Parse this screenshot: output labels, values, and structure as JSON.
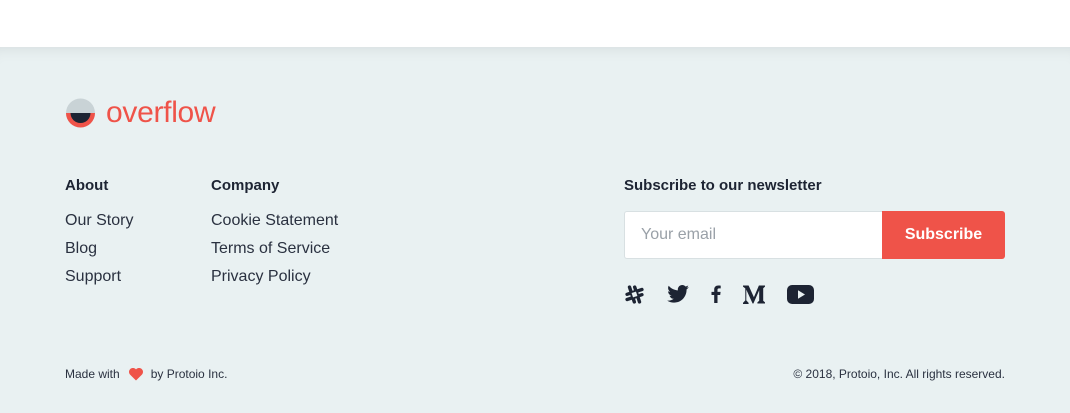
{
  "brand": {
    "name": "overflow",
    "accent_color": "#ef5349",
    "dark_color": "#1d2433"
  },
  "footer": {
    "columns": [
      {
        "title": "About",
        "links": [
          "Our Story",
          "Blog",
          "Support"
        ]
      },
      {
        "title": "Company",
        "links": [
          "Cookie Statement",
          "Terms of Service",
          "Privacy Policy"
        ]
      }
    ],
    "newsletter": {
      "title": "Subscribe to our newsletter",
      "email_placeholder": "Your email",
      "button_label": "Subscribe"
    },
    "social_icons": [
      "slack-icon",
      "twitter-icon",
      "facebook-icon",
      "medium-icon",
      "youtube-icon"
    ],
    "made_with_prefix": "Made with",
    "made_with_suffix": "by Protoio Inc.",
    "copyright": "© 2018, Protoio, Inc. All rights reserved."
  }
}
